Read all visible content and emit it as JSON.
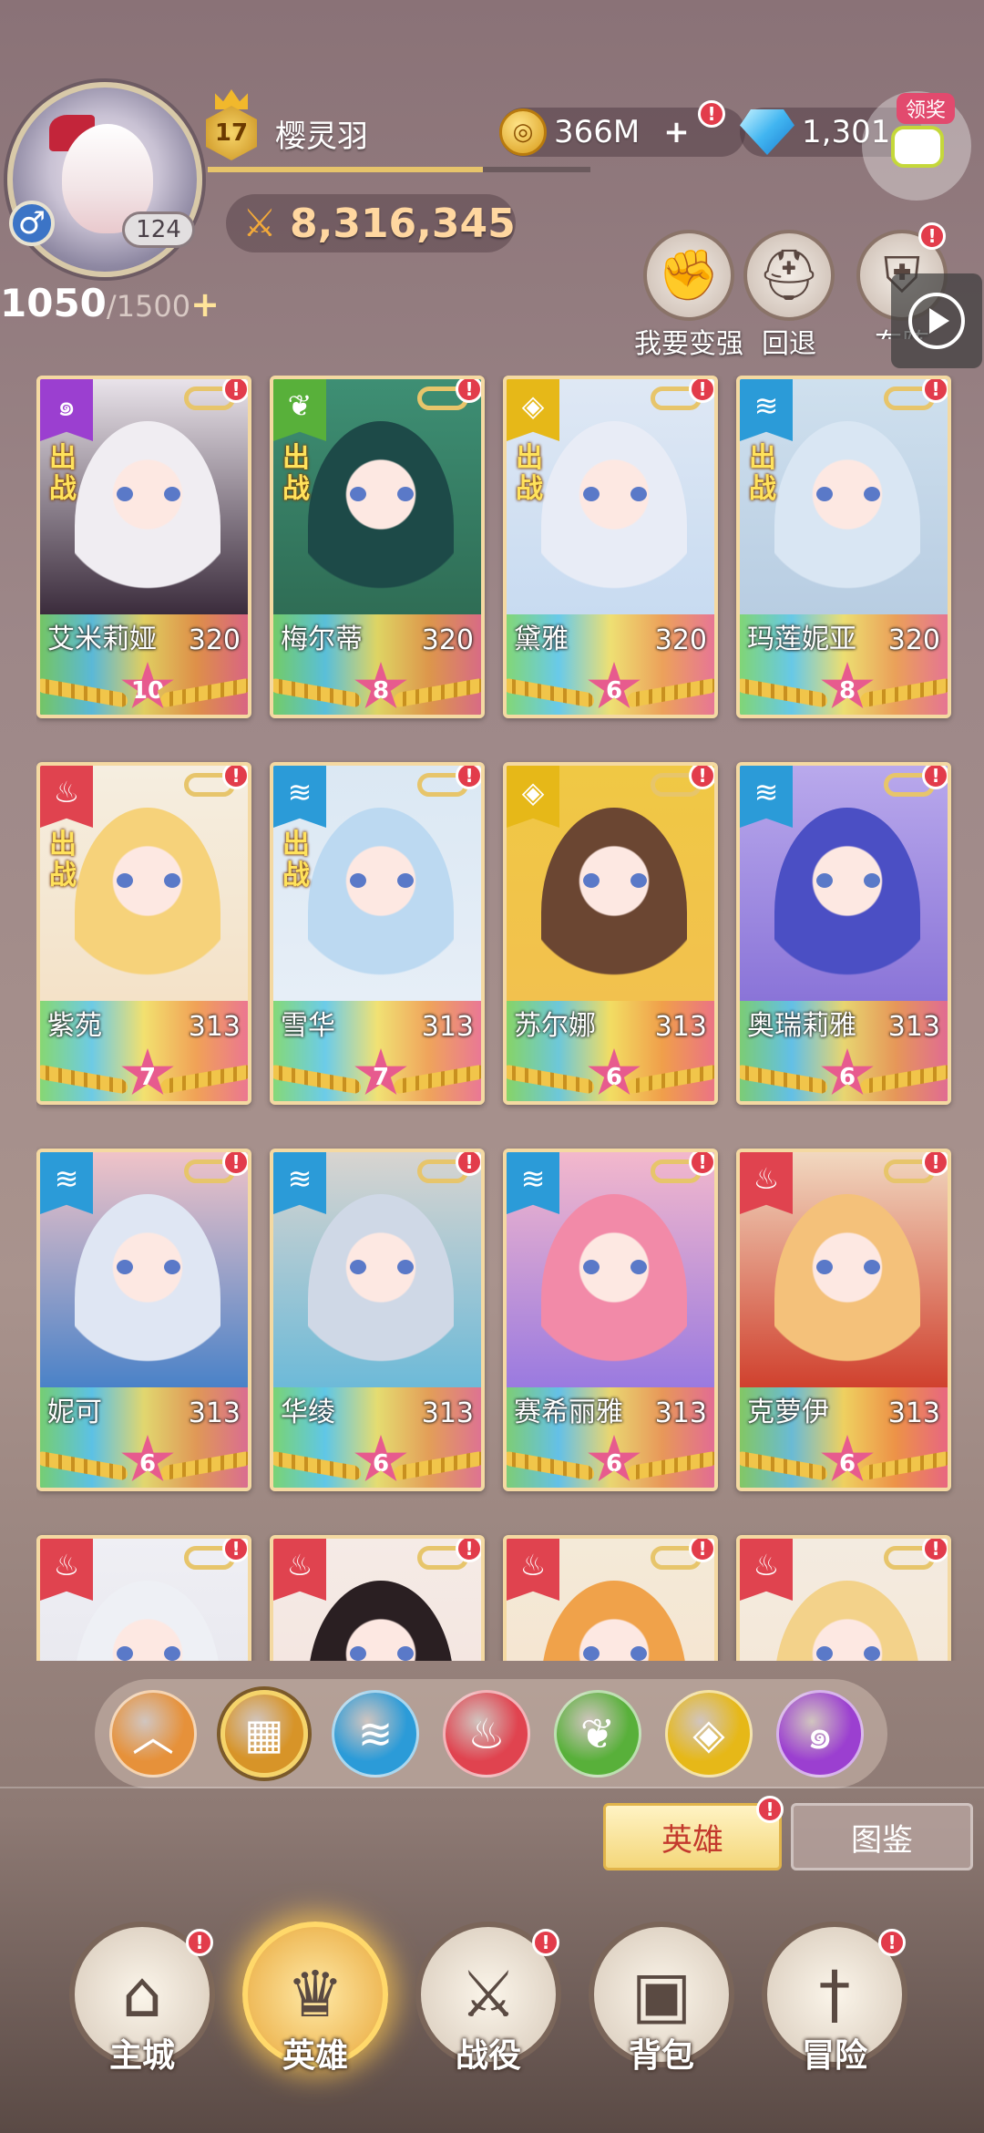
{
  "player": {
    "name": "樱灵羽",
    "level": "17",
    "avatar_level": "124",
    "gender_icon": "male-symbol",
    "power": "8,316,345",
    "xp_progress": 0.72,
    "stamina_current": "1050",
    "stamina_max": "/1500",
    "stamina_plus": "+"
  },
  "resources": {
    "gold": "366M",
    "gems": "1,301",
    "plus": "+"
  },
  "gift": {
    "tag": "领奖",
    "icon": "gamepad-icon"
  },
  "quick_actions": [
    {
      "label": "我要变强",
      "icon": "fist-icon"
    },
    {
      "label": "回退",
      "icon": "helmet-icon"
    },
    {
      "label": "布阵",
      "icon": "shield-icon"
    }
  ],
  "badge_mark": "!",
  "deploy_label": "出战",
  "heroes": [
    {
      "name": "艾米莉娅",
      "level": "320",
      "stars": "10",
      "element": "shadow",
      "deployed": true,
      "hair": "#f0edf2",
      "skin": "#3b2c3c",
      "bg": "#e9e3ea"
    },
    {
      "name": "梅尔蒂",
      "level": "320",
      "stars": "8",
      "element": "nature",
      "deployed": true,
      "hair": "#1d4a48",
      "skin": "#2f6d55",
      "bg": "#3e8f74"
    },
    {
      "name": "黛雅",
      "level": "320",
      "stars": "6",
      "element": "light",
      "deployed": true,
      "hair": "#e8ecf6",
      "skin": "#c8dbf1",
      "bg": "#dfe8f4"
    },
    {
      "name": "玛莲妮亚",
      "level": "320",
      "stars": "8",
      "element": "water",
      "deployed": true,
      "hair": "#d9e6f3",
      "skin": "#b8cde2",
      "bg": "#cfe0ee"
    },
    {
      "name": "紫苑",
      "level": "313",
      "stars": "7",
      "element": "fire",
      "deployed": true,
      "hair": "#f6d27a",
      "skin": "#f4e2c8",
      "bg": "#f5eee0"
    },
    {
      "name": "雪华",
      "level": "313",
      "stars": "7",
      "element": "water",
      "deployed": true,
      "hair": "#bcd9f1",
      "skin": "#e6eef7",
      "bg": "#dbe8f3"
    },
    {
      "name": "苏尔娜",
      "level": "313",
      "stars": "6",
      "element": "light",
      "deployed": false,
      "hair": "#6b4632",
      "skin": "#f2c14e",
      "bg": "#f0c844"
    },
    {
      "name": "奥瑞莉雅",
      "level": "313",
      "stars": "6",
      "element": "water",
      "deployed": false,
      "hair": "#4b4fc4",
      "skin": "#8a74d8",
      "bg": "#b9a9ec"
    },
    {
      "name": "妮可",
      "level": "313",
      "stars": "6",
      "element": "water",
      "deployed": false,
      "hair": "#dfe6f3",
      "skin": "#4a82c8",
      "bg": "#f0c3c8"
    },
    {
      "name": "华绫",
      "level": "313",
      "stars": "6",
      "element": "water",
      "deployed": false,
      "hair": "#cfd8e6",
      "skin": "#6dbad8",
      "bg": "#d8d4d0"
    },
    {
      "name": "赛希丽雅",
      "level": "313",
      "stars": "6",
      "element": "water",
      "deployed": false,
      "hair": "#f28aa8",
      "skin": "#9a7ae0",
      "bg": "#f3b8cc"
    },
    {
      "name": "克萝伊",
      "level": "313",
      "stars": "6",
      "element": "fire",
      "deployed": false,
      "hair": "#f4c17a",
      "skin": "#d0412e",
      "bg": "#f1d8c0"
    },
    {
      "name": "",
      "level": "",
      "stars": "",
      "element": "fire",
      "deployed": false,
      "hair": "#eef0f5",
      "skin": "#e4e4ec",
      "bg": "#efeff4"
    },
    {
      "name": "",
      "level": "",
      "stars": "",
      "element": "fire",
      "deployed": false,
      "hair": "#2a1f22",
      "skin": "#f3e2dc",
      "bg": "#f5ebe6"
    },
    {
      "name": "",
      "level": "",
      "stars": "",
      "element": "fire",
      "deployed": false,
      "hair": "#f0a24a",
      "skin": "#f6e2cc",
      "bg": "#f4ead8"
    },
    {
      "name": "",
      "level": "",
      "stars": "",
      "element": "fire",
      "deployed": false,
      "hair": "#f3d28a",
      "skin": "#f6e6d2",
      "bg": "#f3ebe0"
    }
  ],
  "element_colors": {
    "shadow": "#9b3fd0",
    "nature": "#58b03a",
    "light": "#e6b818",
    "water": "#2b9bd8",
    "fire": "#e0434f"
  },
  "element_icons": {
    "shadow": "swirl-icon",
    "nature": "leaf-icon",
    "light": "eye-icon",
    "water": "wave-icon",
    "fire": "flame-icon"
  },
  "filters": [
    {
      "name": "collapse",
      "icon": "chevron-up-icon",
      "color": "#e6913a"
    },
    {
      "name": "all",
      "icon": "grid-icon",
      "color": "#d79428",
      "active": true
    },
    {
      "name": "water",
      "icon": "wave-icon",
      "color": "#2b9bd8"
    },
    {
      "name": "fire",
      "icon": "flame-icon",
      "color": "#e0434f"
    },
    {
      "name": "nature",
      "icon": "leaf-icon",
      "color": "#58b03a"
    },
    {
      "name": "light",
      "icon": "eye-icon",
      "color": "#e6b818"
    },
    {
      "name": "shadow",
      "icon": "swirl-icon",
      "color": "#9b3fd0"
    }
  ],
  "view_tabs": {
    "heroes": "英雄",
    "codex": "图鉴"
  },
  "nav": [
    {
      "label": "主城",
      "icon": "castle-icon",
      "badge": true
    },
    {
      "label": "英雄",
      "icon": "hero-icon",
      "active": true
    },
    {
      "label": "战役",
      "icon": "crossed-swords-icon",
      "badge": true
    },
    {
      "label": "背包",
      "icon": "backpack-icon",
      "badge": false
    },
    {
      "label": "冒险",
      "icon": "sword-icon",
      "badge": true
    }
  ]
}
